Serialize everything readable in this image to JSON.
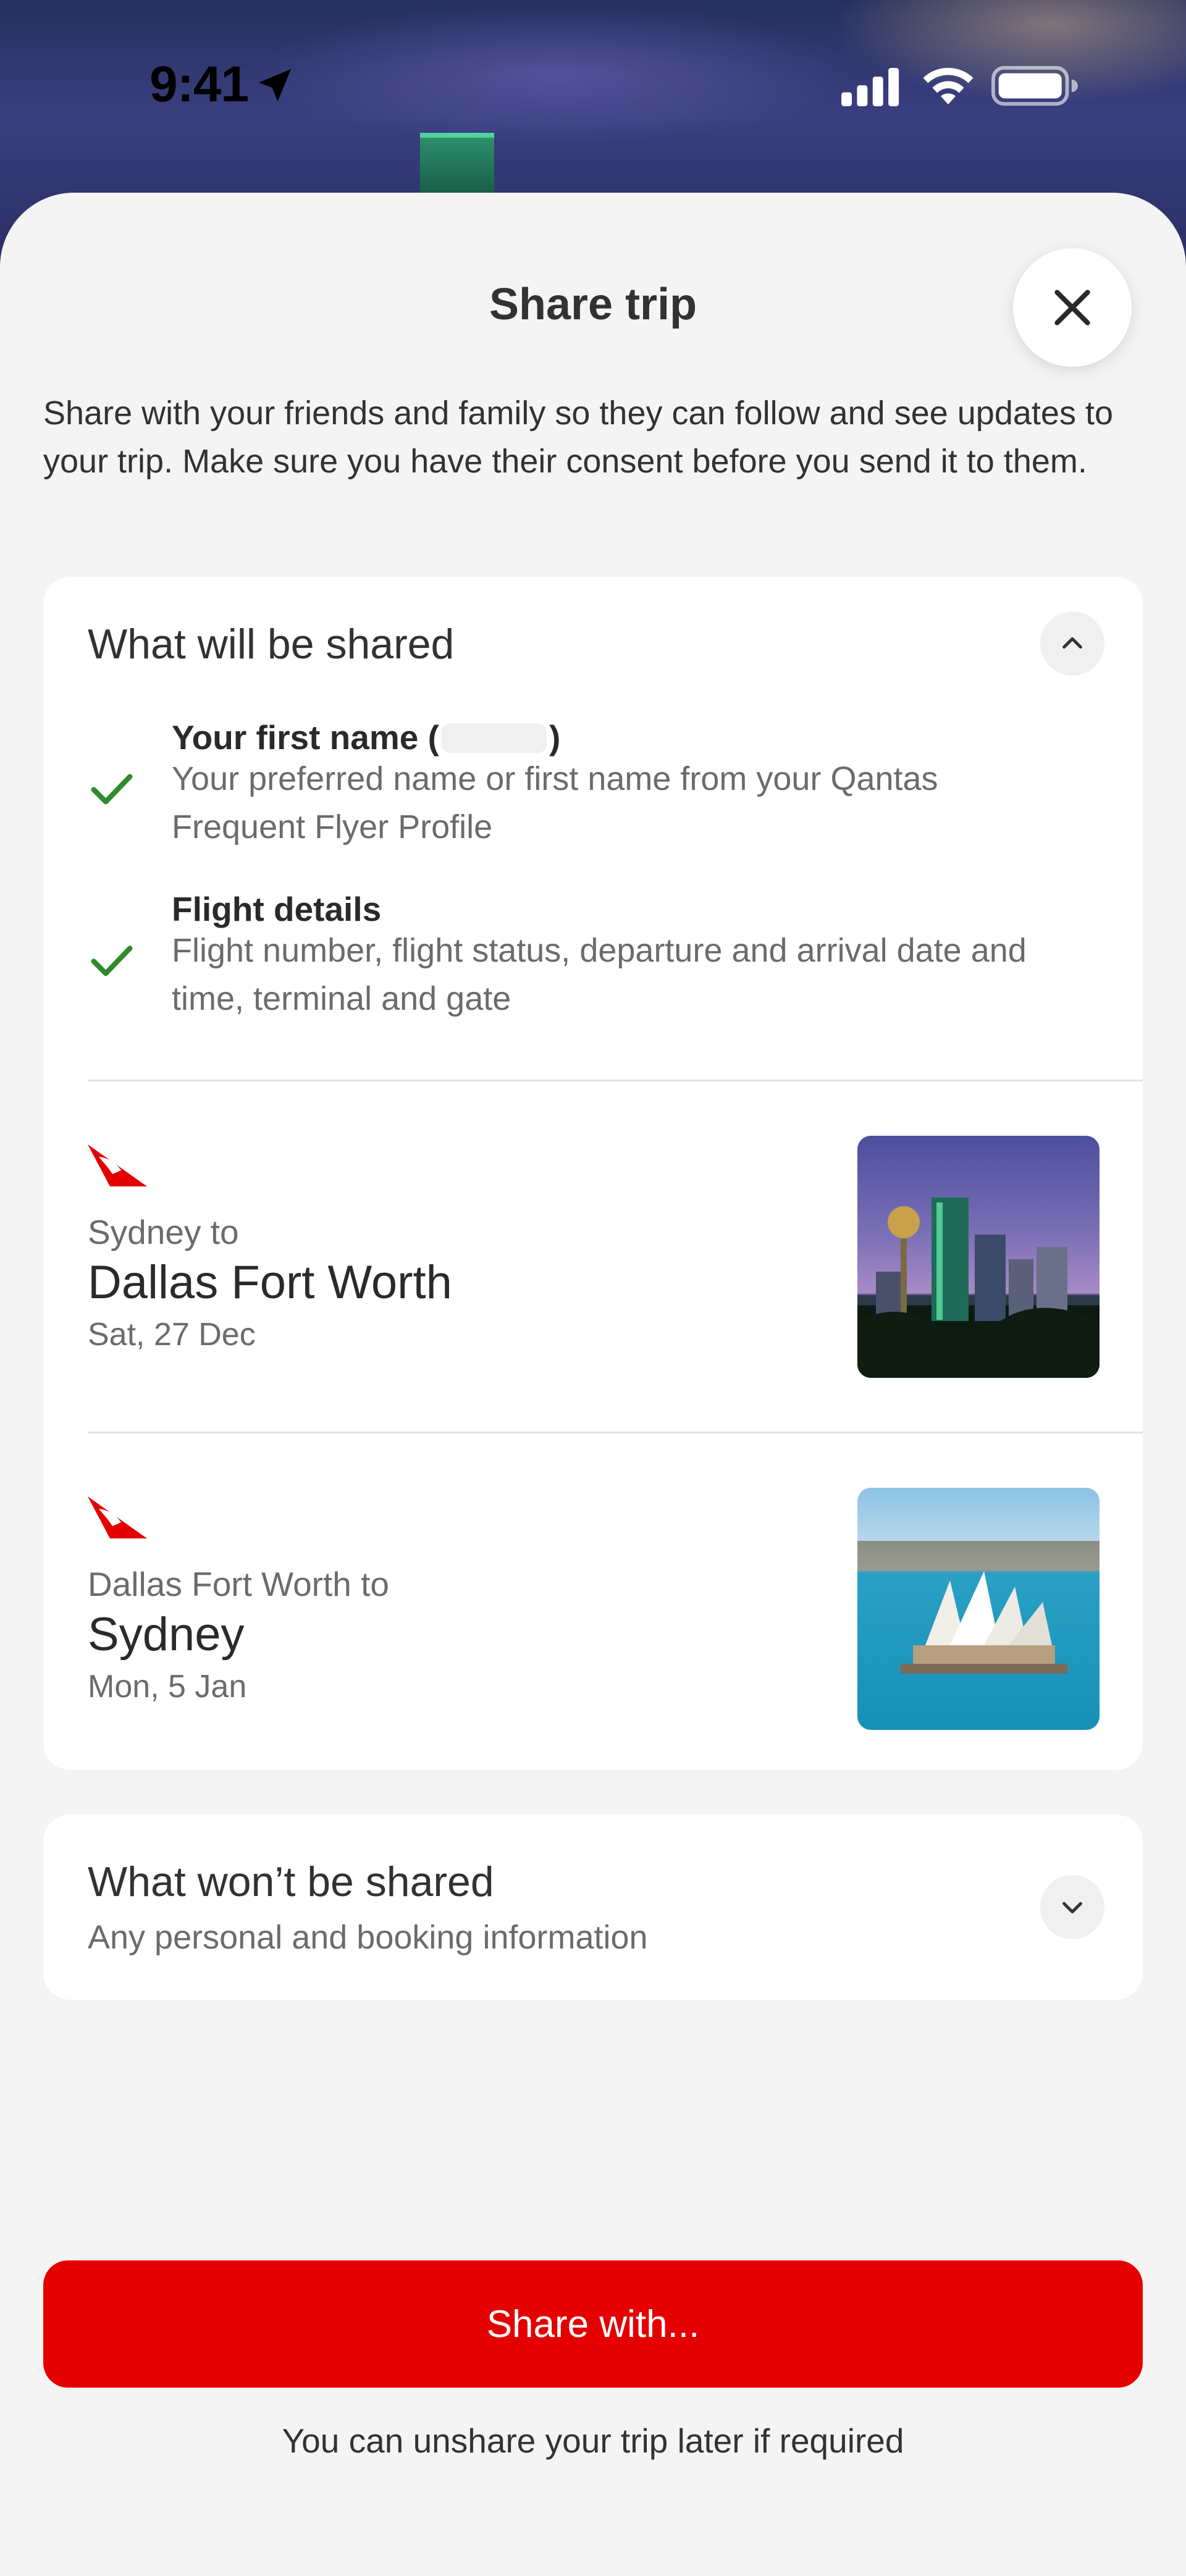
{
  "status_bar": {
    "time": "9:41",
    "icons": [
      "location-arrow-icon",
      "cellular-signal-icon",
      "wifi-icon",
      "battery-icon"
    ]
  },
  "sheet": {
    "title": "Share trip",
    "close_icon": "close-icon",
    "intro": "Share with your friends and family so they can follow and see updates to your trip. Make sure you have their consent before you send it to them."
  },
  "shared_section": {
    "title": "What will be shared",
    "toggle_icon": "chevron-up-icon",
    "items": [
      {
        "title_prefix": "Your first name (",
        "title_suffix": ")",
        "description": "Your preferred name or first name from your Qantas Frequent Flyer Profile"
      },
      {
        "title": "Flight details",
        "description": "Flight number, flight status, departure and arrival date and time, terminal and gate"
      }
    ],
    "trips": [
      {
        "from": "Sydney to",
        "destination": "Dallas Fort Worth",
        "date": "Sat, 27 Dec",
        "image": "dallas-skyline"
      },
      {
        "from": "Dallas Fort Worth to",
        "destination": "Sydney",
        "date": "Mon, 5 Jan",
        "image": "sydney-opera-house"
      }
    ]
  },
  "not_shared_section": {
    "title": "What won’t be shared",
    "subtitle": "Any personal and booking information",
    "toggle_icon": "chevron-down-icon"
  },
  "actions": {
    "share_label": "Share with...",
    "footnote": "You can unshare your trip later if required"
  },
  "colors": {
    "brand_red": "#e40000",
    "check_green": "#2e8b2e",
    "sheet_bg": "#f4f4f5"
  }
}
